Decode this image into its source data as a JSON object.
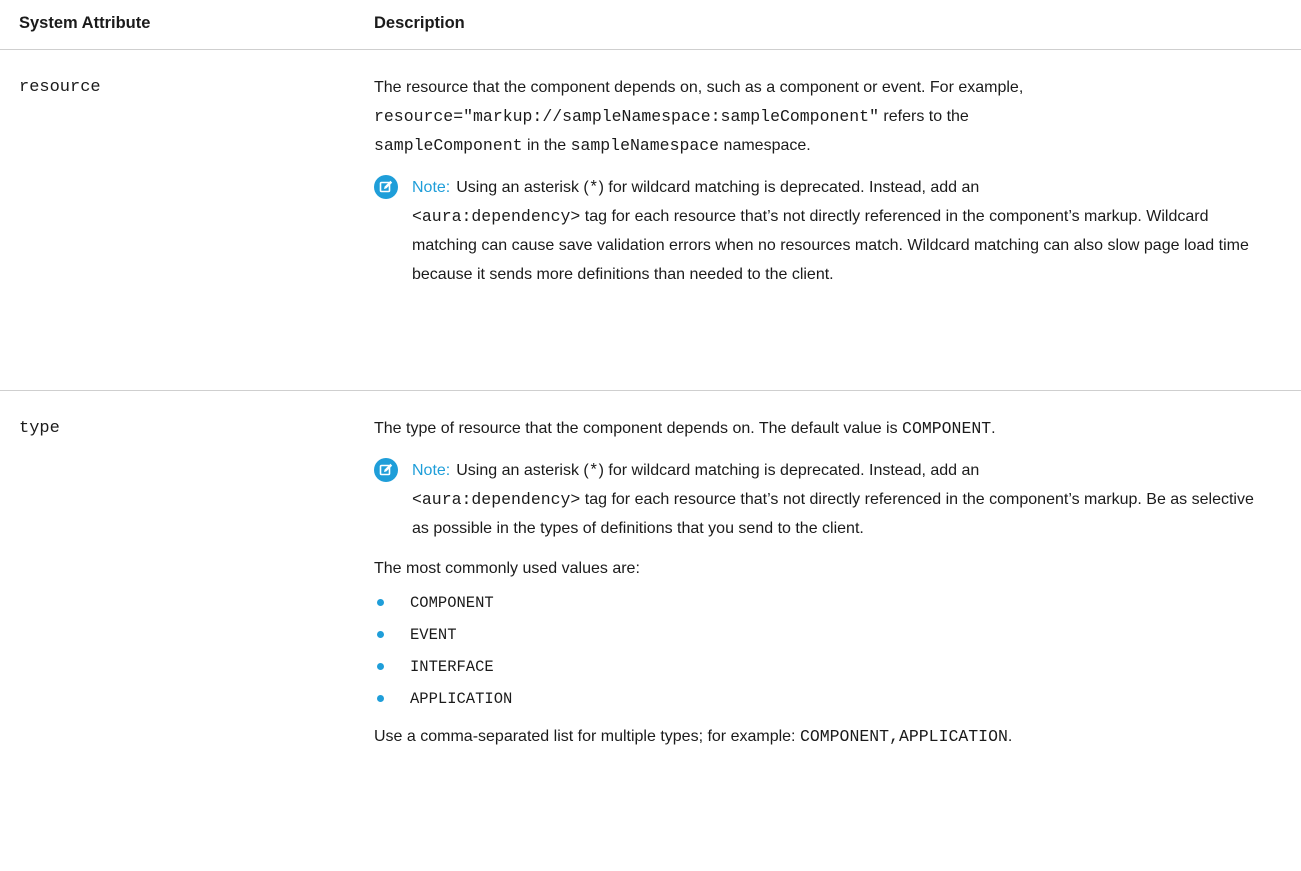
{
  "table": {
    "headers": {
      "attribute": "System Attribute",
      "description": "Description"
    },
    "rows": [
      {
        "name": "resource",
        "desc_parts": {
          "p1_a": "The resource that the component depends on, such as a component or event. For example,",
          "p1_code1": "resource=\"markup://sampleNamespace:sampleComponent\"",
          "p1_b": " refers to the",
          "p1_code2": "sampleComponent",
          "p1_c": " in the ",
          "p1_code3": "sampleNamespace",
          "p1_d": " namespace."
        },
        "note": {
          "label": "Note:",
          "t1": "Using an asterisk (",
          "code_star": "*",
          "t2": ") for wildcard matching is deprecated. Instead, add an",
          "code_tag": "<aura:dependency>",
          "t3": " tag for each resource that’s not directly referenced in the component’s markup. Wildcard matching can cause save validation errors when no resources match. Wildcard matching can also slow page load time because it sends more definitions than needed to the client."
        }
      },
      {
        "name": "type",
        "desc_parts": {
          "p1_a": "The type of resource that the component depends on. The default value is ",
          "p1_code1": "COMPONENT",
          "p1_b": "."
        },
        "note": {
          "label": "Note:",
          "t1": "Using an asterisk (",
          "code_star": "*",
          "t2": ") for wildcard matching is deprecated. Instead, add an",
          "code_tag": "<aura:dependency>",
          "t3": " tag for each resource that’s not directly referenced in the component’s markup. Be as selective as possible in the types of definitions that you send to the client."
        },
        "values_intro": "The most commonly used values are:",
        "values": [
          "COMPONENT",
          "EVENT",
          "INTERFACE",
          "APPLICATION"
        ],
        "final_a": "Use a comma-separated list for multiple types; for example: ",
        "final_code": "COMPONENT,APPLICATION",
        "final_b": "."
      }
    ]
  },
  "colors": {
    "accent": "#1f9ed9",
    "text": "#1b1b1b",
    "divider": "#cfcfcf"
  },
  "icons": {
    "note": "edit-note-icon",
    "bullet": "bullet-dot-icon"
  }
}
